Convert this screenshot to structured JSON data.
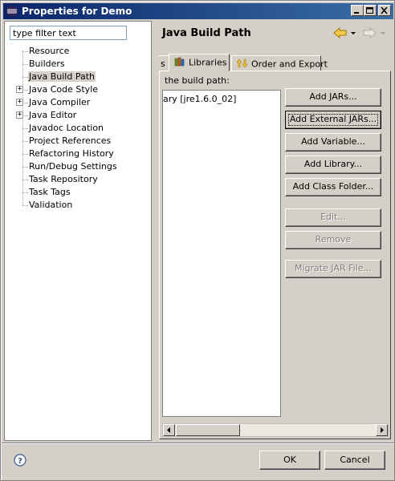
{
  "window": {
    "title": "Properties for Demo"
  },
  "filter": {
    "value": "type filter text"
  },
  "tree": {
    "items": [
      {
        "label": "Resource",
        "expandable": false
      },
      {
        "label": "Builders",
        "expandable": false
      },
      {
        "label": "Java Build Path",
        "expandable": false,
        "selected": true
      },
      {
        "label": "Java Code Style",
        "expandable": true
      },
      {
        "label": "Java Compiler",
        "expandable": true
      },
      {
        "label": "Java Editor",
        "expandable": true
      },
      {
        "label": "Javadoc Location",
        "expandable": false
      },
      {
        "label": "Project References",
        "expandable": false
      },
      {
        "label": "Refactoring History",
        "expandable": false
      },
      {
        "label": "Run/Debug Settings",
        "expandable": false
      },
      {
        "label": "Task Repository",
        "expandable": false
      },
      {
        "label": "Task Tags",
        "expandable": false
      },
      {
        "label": "Validation",
        "expandable": false
      }
    ]
  },
  "page": {
    "title": "Java Build Path"
  },
  "tabs": {
    "cut_label": "s",
    "libraries": "Libraries",
    "order_export": "Order and Export"
  },
  "libraries": {
    "description": " the build path:",
    "list_items": [
      "ary [jre1.6.0_02]"
    ]
  },
  "buttons": {
    "add_jars": "Add JARs...",
    "add_external_jars": "Add External JARs...",
    "add_variable": "Add Variable...",
    "add_library": "Add Library...",
    "add_class_folder": "Add Class Folder...",
    "edit": "Edit...",
    "remove": "Remove",
    "migrate_jar": "Migrate JAR File..."
  },
  "footer": {
    "ok": "OK",
    "cancel": "Cancel"
  },
  "colors": {
    "title_bar": "#0a246a",
    "selection": "#d4d0c8",
    "window_bg": "#d4d0c8"
  }
}
